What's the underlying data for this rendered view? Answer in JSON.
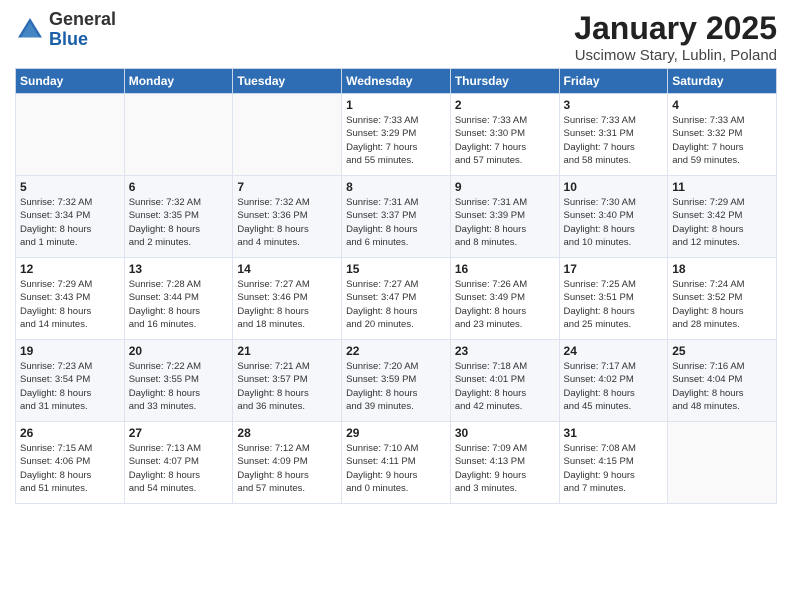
{
  "logo": {
    "general": "General",
    "blue": "Blue"
  },
  "title": "January 2025",
  "location": "Uscimow Stary, Lublin, Poland",
  "weekdays": [
    "Sunday",
    "Monday",
    "Tuesday",
    "Wednesday",
    "Thursday",
    "Friday",
    "Saturday"
  ],
  "weeks": [
    [
      {
        "day": "",
        "info": ""
      },
      {
        "day": "",
        "info": ""
      },
      {
        "day": "",
        "info": ""
      },
      {
        "day": "1",
        "info": "Sunrise: 7:33 AM\nSunset: 3:29 PM\nDaylight: 7 hours\nand 55 minutes."
      },
      {
        "day": "2",
        "info": "Sunrise: 7:33 AM\nSunset: 3:30 PM\nDaylight: 7 hours\nand 57 minutes."
      },
      {
        "day": "3",
        "info": "Sunrise: 7:33 AM\nSunset: 3:31 PM\nDaylight: 7 hours\nand 58 minutes."
      },
      {
        "day": "4",
        "info": "Sunrise: 7:33 AM\nSunset: 3:32 PM\nDaylight: 7 hours\nand 59 minutes."
      }
    ],
    [
      {
        "day": "5",
        "info": "Sunrise: 7:32 AM\nSunset: 3:34 PM\nDaylight: 8 hours\nand 1 minute."
      },
      {
        "day": "6",
        "info": "Sunrise: 7:32 AM\nSunset: 3:35 PM\nDaylight: 8 hours\nand 2 minutes."
      },
      {
        "day": "7",
        "info": "Sunrise: 7:32 AM\nSunset: 3:36 PM\nDaylight: 8 hours\nand 4 minutes."
      },
      {
        "day": "8",
        "info": "Sunrise: 7:31 AM\nSunset: 3:37 PM\nDaylight: 8 hours\nand 6 minutes."
      },
      {
        "day": "9",
        "info": "Sunrise: 7:31 AM\nSunset: 3:39 PM\nDaylight: 8 hours\nand 8 minutes."
      },
      {
        "day": "10",
        "info": "Sunrise: 7:30 AM\nSunset: 3:40 PM\nDaylight: 8 hours\nand 10 minutes."
      },
      {
        "day": "11",
        "info": "Sunrise: 7:29 AM\nSunset: 3:42 PM\nDaylight: 8 hours\nand 12 minutes."
      }
    ],
    [
      {
        "day": "12",
        "info": "Sunrise: 7:29 AM\nSunset: 3:43 PM\nDaylight: 8 hours\nand 14 minutes."
      },
      {
        "day": "13",
        "info": "Sunrise: 7:28 AM\nSunset: 3:44 PM\nDaylight: 8 hours\nand 16 minutes."
      },
      {
        "day": "14",
        "info": "Sunrise: 7:27 AM\nSunset: 3:46 PM\nDaylight: 8 hours\nand 18 minutes."
      },
      {
        "day": "15",
        "info": "Sunrise: 7:27 AM\nSunset: 3:47 PM\nDaylight: 8 hours\nand 20 minutes."
      },
      {
        "day": "16",
        "info": "Sunrise: 7:26 AM\nSunset: 3:49 PM\nDaylight: 8 hours\nand 23 minutes."
      },
      {
        "day": "17",
        "info": "Sunrise: 7:25 AM\nSunset: 3:51 PM\nDaylight: 8 hours\nand 25 minutes."
      },
      {
        "day": "18",
        "info": "Sunrise: 7:24 AM\nSunset: 3:52 PM\nDaylight: 8 hours\nand 28 minutes."
      }
    ],
    [
      {
        "day": "19",
        "info": "Sunrise: 7:23 AM\nSunset: 3:54 PM\nDaylight: 8 hours\nand 31 minutes."
      },
      {
        "day": "20",
        "info": "Sunrise: 7:22 AM\nSunset: 3:55 PM\nDaylight: 8 hours\nand 33 minutes."
      },
      {
        "day": "21",
        "info": "Sunrise: 7:21 AM\nSunset: 3:57 PM\nDaylight: 8 hours\nand 36 minutes."
      },
      {
        "day": "22",
        "info": "Sunrise: 7:20 AM\nSunset: 3:59 PM\nDaylight: 8 hours\nand 39 minutes."
      },
      {
        "day": "23",
        "info": "Sunrise: 7:18 AM\nSunset: 4:01 PM\nDaylight: 8 hours\nand 42 minutes."
      },
      {
        "day": "24",
        "info": "Sunrise: 7:17 AM\nSunset: 4:02 PM\nDaylight: 8 hours\nand 45 minutes."
      },
      {
        "day": "25",
        "info": "Sunrise: 7:16 AM\nSunset: 4:04 PM\nDaylight: 8 hours\nand 48 minutes."
      }
    ],
    [
      {
        "day": "26",
        "info": "Sunrise: 7:15 AM\nSunset: 4:06 PM\nDaylight: 8 hours\nand 51 minutes."
      },
      {
        "day": "27",
        "info": "Sunrise: 7:13 AM\nSunset: 4:07 PM\nDaylight: 8 hours\nand 54 minutes."
      },
      {
        "day": "28",
        "info": "Sunrise: 7:12 AM\nSunset: 4:09 PM\nDaylight: 8 hours\nand 57 minutes."
      },
      {
        "day": "29",
        "info": "Sunrise: 7:10 AM\nSunset: 4:11 PM\nDaylight: 9 hours\nand 0 minutes."
      },
      {
        "day": "30",
        "info": "Sunrise: 7:09 AM\nSunset: 4:13 PM\nDaylight: 9 hours\nand 3 minutes."
      },
      {
        "day": "31",
        "info": "Sunrise: 7:08 AM\nSunset: 4:15 PM\nDaylight: 9 hours\nand 7 minutes."
      },
      {
        "day": "",
        "info": ""
      }
    ]
  ]
}
